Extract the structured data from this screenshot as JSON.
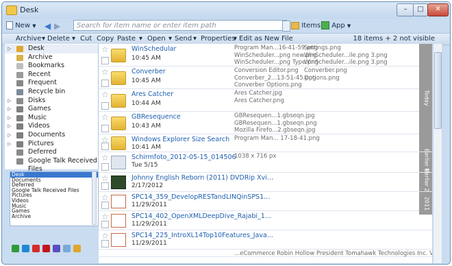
{
  "window": {
    "title": "Desk",
    "min": "–",
    "max": "□",
    "close": "✕"
  },
  "toolbar": {
    "new_label": "New",
    "search_placeholder": "Search for item name or enter item path",
    "items_label": "Items",
    "app_label": "App"
  },
  "actions": [
    "Archive",
    "Delete",
    "Cut",
    "Copy",
    "Paste",
    "Open",
    "Send",
    "Properties",
    "Edit as New File"
  ],
  "item_count": "18 items + 2 not visible",
  "sidebar": [
    {
      "label": "Desk",
      "icon": "desk-icon",
      "arrow": "▷",
      "color": "#e0a52d"
    },
    {
      "label": "Archive",
      "icon": "archive-icon",
      "arrow": "",
      "color": "#d9b24a"
    },
    {
      "label": "Bookmarks",
      "icon": "star-icon",
      "arrow": "",
      "color": "#bdbdbd"
    },
    {
      "label": "Recent",
      "icon": "clock-icon",
      "arrow": "",
      "color": "#9a9a9a"
    },
    {
      "label": "Frequent",
      "icon": "frequent-icon",
      "arrow": "",
      "color": "#888"
    },
    {
      "label": "Recycle bin",
      "icon": "recycle-bin-icon",
      "arrow": "",
      "color": "#7c8a98"
    },
    {
      "label": "Disks",
      "icon": "disk-icon",
      "arrow": "▷",
      "color": "#8c8c8c"
    },
    {
      "label": "Games",
      "icon": "library-icon",
      "arrow": "▷",
      "color": "#7f7f7f"
    },
    {
      "label": "Music",
      "icon": "library-icon",
      "arrow": "▷",
      "color": "#7f7f7f"
    },
    {
      "label": "Videos",
      "icon": "library-icon",
      "arrow": "▷",
      "color": "#7f7f7f"
    },
    {
      "label": "Documents",
      "icon": "library-icon",
      "arrow": "▷",
      "color": "#7f7f7f"
    },
    {
      "label": "Pictures",
      "icon": "library-icon",
      "arrow": "▷",
      "color": "#7f7f7f"
    },
    {
      "label": "Deferred",
      "icon": "deferred-icon",
      "arrow": "",
      "color": "#8a8a8a"
    },
    {
      "label": "Google Talk Received Files",
      "icon": "folder-icon",
      "arrow": "",
      "color": "#8a8a8a"
    }
  ],
  "bottom_list": [
    "Desk",
    "Documents",
    "Deferred",
    "Google Talk Received Files",
    "Pictures",
    "Videos",
    "Music",
    "Games",
    "Archive"
  ],
  "rows": [
    {
      "name": "WinSchedular",
      "meta": "10:45 AM",
      "type": "folder",
      "details": [
        "Program Man...16-41-59.png",
        "WinScheduler...png new.png",
        "WinScheduler...png Type.png"
      ],
      "details2": [
        "Settings.png",
        "WinScheduler...ile.png 3.png",
        "WinScheduler...ile.png 3.png"
      ]
    },
    {
      "name": "Converber",
      "meta": "10:45 AM",
      "type": "folder",
      "details": [
        "Conversion Editor.png",
        "Converber_2...13-51-45.png",
        "Converber Options.png"
      ],
      "details2": [
        "Converber.png",
        "Options.png",
        ""
      ]
    },
    {
      "name": "Ares Catcher",
      "meta": "10:44 AM",
      "type": "folder",
      "details": [
        "Ares Catcher.jpg",
        "Ares Catcher.png",
        ""
      ],
      "details2": [
        "",
        "",
        ""
      ]
    },
    {
      "name": "GBResequence",
      "meta": "10:43 AM",
      "type": "folder",
      "details": [
        "GBResequen...1.gbseqn.jpg",
        "GBResequen...1.gbseqn.png",
        "Mozilla Firefo...2.gbseqn.jpg"
      ],
      "details2": [
        "",
        "",
        ""
      ]
    },
    {
      "name": "Windows Explorer Size Search",
      "meta": "10:41 AM",
      "type": "folder",
      "details": [
        "Program Man... 17-18-41.png",
        "",
        ""
      ],
      "details2": [
        "",
        "",
        ""
      ]
    },
    {
      "name": "Schirmfoto_2012-05-15_014506",
      "meta": "Tue 5/15",
      "type": "image",
      "details": [
        "1038 x 716 px",
        "",
        ""
      ],
      "details2": [
        "",
        "",
        ""
      ]
    },
    {
      "name": "Johnny English Reborn (2011) DVDRip Xvi...",
      "meta": "2/17/2012",
      "type": "video",
      "details": [
        "",
        "",
        ""
      ],
      "details2": [
        "",
        "",
        ""
      ]
    },
    {
      "name": "SPC14_359_DevelopRESTandLINQinSPS1...",
      "meta": "11/29/2011",
      "type": "ppt",
      "details": [
        "",
        "",
        ""
      ],
      "details2": [
        "",
        "",
        ""
      ]
    },
    {
      "name": "SPC14_402_OpenXMLDeepDive_Rajabi_1...",
      "meta": "11/29/2011",
      "type": "ppt",
      "details": [
        "",
        "",
        ""
      ],
      "details2": [
        "",
        "",
        ""
      ]
    },
    {
      "name": "SPC14_225_IntroXL14Top10Features_Java...",
      "meta": "11/29/2011",
      "type": "ppt",
      "details": [
        "",
        "",
        ""
      ],
      "details2": [
        "",
        "",
        ""
      ]
    }
  ],
  "partial_row_text": "...eCommerce Robin Hollow President Tomahawk Technologies Inc. Victoria Street...",
  "groups": [
    "Today",
    "Earlier May",
    "Earlier 2012",
    "2011"
  ],
  "quick_icons": [
    {
      "name": "whatsapp-icon",
      "color": "#2f9a3a"
    },
    {
      "name": "skype-icon",
      "color": "#1e88d6"
    },
    {
      "name": "red-star-icon",
      "color": "#d42b2b"
    },
    {
      "name": "acrobat-icon",
      "color": "#c0161a"
    },
    {
      "name": "app-icon",
      "color": "#5a4ec0"
    },
    {
      "name": "notepad-icon",
      "color": "#7aa9d6"
    },
    {
      "name": "image-editor-icon",
      "color": "#e0a52d"
    }
  ],
  "colors": {
    "accent": "#3a78cf",
    "link": "#1f5fb0",
    "group_tab": "#9a9a9a"
  }
}
